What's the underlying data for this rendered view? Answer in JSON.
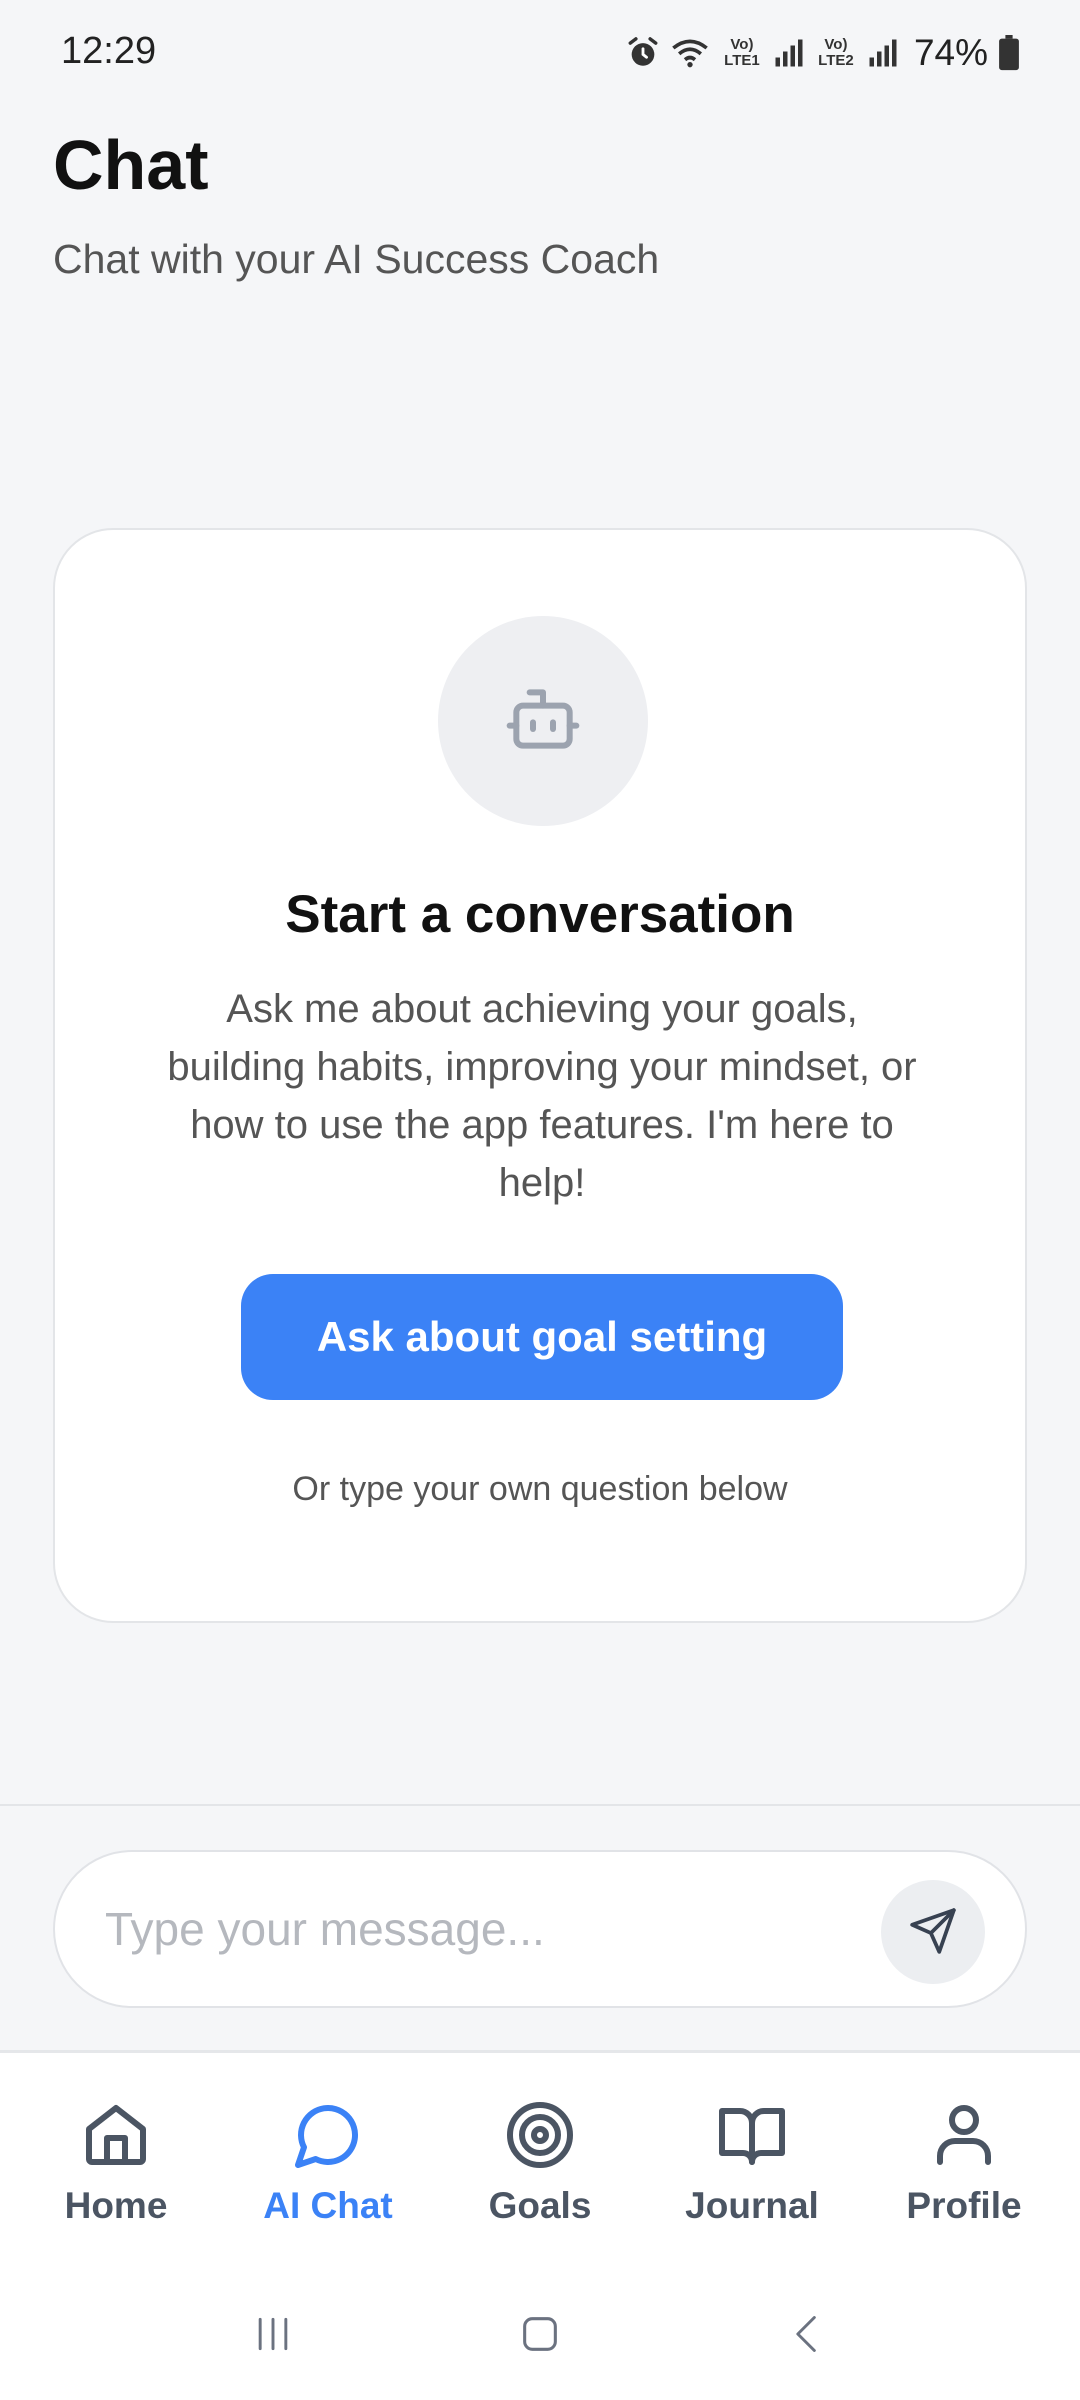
{
  "status_bar": {
    "time": "12:29",
    "sim1_label": "Vo) LTE1",
    "sim2_label": "Vo) LTE2",
    "battery": "74%",
    "icons": [
      "alarm-icon",
      "wifi-icon",
      "signal-icon",
      "signal-icon",
      "battery-icon"
    ]
  },
  "header": {
    "title": "Chat",
    "subtitle": "Chat with your AI Success Coach"
  },
  "empty_state": {
    "icon": "bot-icon",
    "title": "Start a conversation",
    "description": "Ask me about achieving your goals, building habits, improving your mindset, or how to use the app features. I'm here to help!",
    "cta_label": "Ask about goal setting",
    "hint": "Or type your own question below"
  },
  "composer": {
    "placeholder": "Type your message...",
    "send_icon": "send-icon"
  },
  "bottom_nav": {
    "items": [
      {
        "label": "Home",
        "icon": "home-icon",
        "active": false
      },
      {
        "label": "AI Chat",
        "icon": "chat-bubble-icon",
        "active": true
      },
      {
        "label": "Goals",
        "icon": "target-icon",
        "active": false
      },
      {
        "label": "Journal",
        "icon": "book-icon",
        "active": false
      },
      {
        "label": "Profile",
        "icon": "user-icon",
        "active": false
      }
    ]
  },
  "colors": {
    "accent": "#3b82f6",
    "background": "#f5f6f8",
    "card": "#ffffff",
    "muted_text": "#555555"
  }
}
